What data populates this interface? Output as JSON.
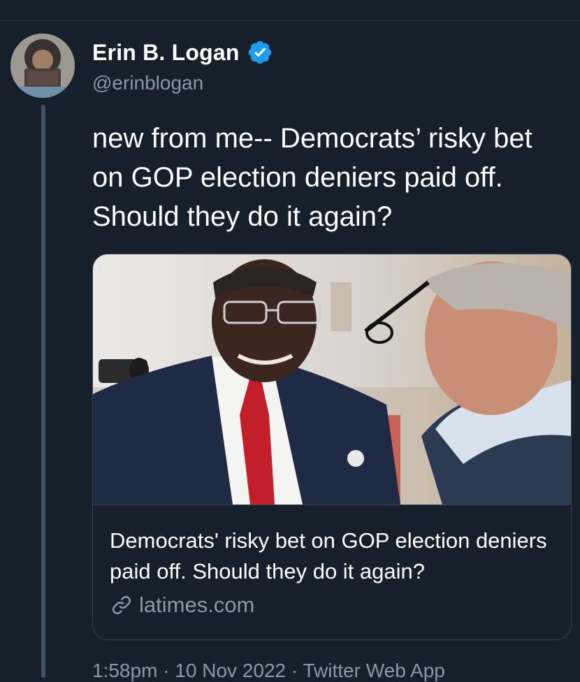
{
  "tweet": {
    "author": {
      "display_name": "Erin B. Logan",
      "handle": "@erinblogan",
      "verified": true
    },
    "text": "new from me-- Democrats’ risky bet on GOP election deniers paid off. Should they do it again?",
    "card": {
      "title": "Democrats' risky bet on GOP election deniers paid off. Should they do it again?",
      "domain": "latimes.com",
      "image_alt": "Photo of a smiling man in suit and red tie talking with another man"
    },
    "meta": {
      "time": "1:58pm",
      "separator": "·",
      "date": "10 Nov 2022",
      "source": "Twitter Web App"
    }
  },
  "colors": {
    "background": "#15202b",
    "secondary_text": "#8899a6",
    "verified_blue": "#1d9bf0",
    "border": "#38444d"
  },
  "icons": [
    "verified-badge-icon",
    "link-icon"
  ]
}
